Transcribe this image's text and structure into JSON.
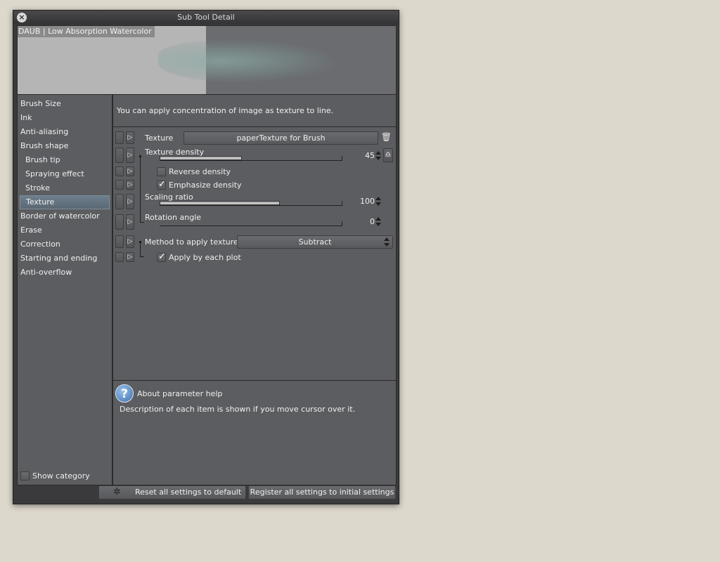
{
  "window": {
    "title": "Sub Tool Detail",
    "close_icon": "close-icon"
  },
  "preview": {
    "label": "DAUB | Low Absorption Watercolor"
  },
  "sidebar": {
    "items": [
      {
        "label": "Brush Size",
        "sub": false,
        "active": false
      },
      {
        "label": "Ink",
        "sub": false,
        "active": false
      },
      {
        "label": "Anti-aliasing",
        "sub": false,
        "active": false
      },
      {
        "label": "Brush shape",
        "sub": false,
        "active": false
      },
      {
        "label": "Brush tip",
        "sub": true,
        "active": false
      },
      {
        "label": "Spraying effect",
        "sub": true,
        "active": false
      },
      {
        "label": "Stroke",
        "sub": true,
        "active": false
      },
      {
        "label": "Texture",
        "sub": true,
        "active": true
      },
      {
        "label": "Border of watercolor",
        "sub": false,
        "active": false
      },
      {
        "label": "Erase",
        "sub": false,
        "active": false
      },
      {
        "label": "Correction",
        "sub": false,
        "active": false
      },
      {
        "label": "Starting and ending",
        "sub": false,
        "active": false
      },
      {
        "label": "Anti-overflow",
        "sub": false,
        "active": false
      }
    ],
    "show_category": {
      "label": "Show category",
      "checked": false
    }
  },
  "main": {
    "description": "You can apply concentration of image as texture to line.",
    "params": {
      "texture": {
        "label": "Texture",
        "value": "paperTexture for Brush",
        "icon": "trash-icon"
      },
      "texture_density": {
        "label": "Texture density",
        "value": "45",
        "fraction": 0.45,
        "icon": "pen-pressure-icon"
      },
      "reverse_density": {
        "label": "Reverse density",
        "checked": false
      },
      "emphasize_density": {
        "label": "Emphasize density",
        "checked": true
      },
      "scaling_ratio": {
        "label": "Scaling ratio",
        "value": "100",
        "fraction": 0.66
      },
      "rotation_angle": {
        "label": "Rotation angle",
        "value": "0",
        "fraction": 0
      },
      "method": {
        "label": "Method to apply texture",
        "value": "Subtract"
      },
      "apply_each_plot": {
        "label": "Apply by each plot",
        "checked": true
      }
    },
    "help": {
      "title": "About parameter help",
      "text": "Description of each item is shown if you move cursor over it."
    }
  },
  "footer": {
    "reset_label": "Reset all settings to default",
    "register_label": "Register all settings to initial settings"
  }
}
